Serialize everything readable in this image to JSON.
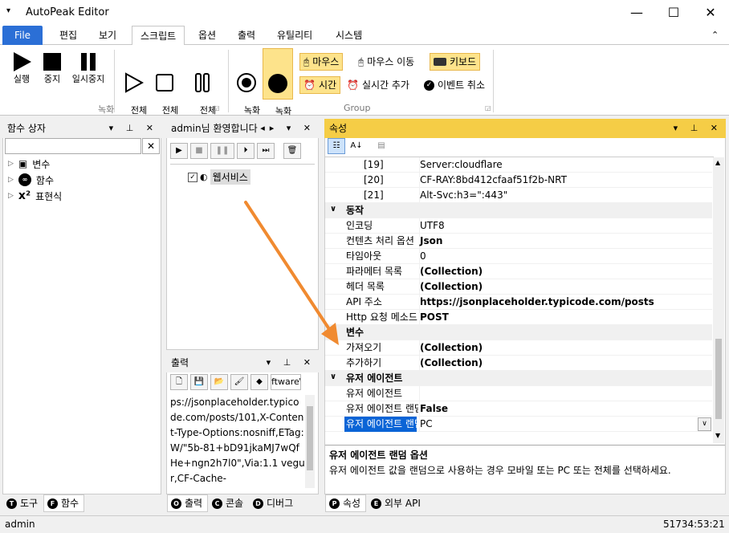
{
  "titlebar": {
    "title": "AutoPeak Editor",
    "min": "—",
    "max": "☐",
    "close": "✕"
  },
  "tabs": [
    {
      "label": "File"
    },
    {
      "label": "편집"
    },
    {
      "label": "보기"
    },
    {
      "label": "스크립트"
    },
    {
      "label": "옵션"
    },
    {
      "label": "출력"
    },
    {
      "label": "유틸리티"
    },
    {
      "label": "시스템"
    }
  ],
  "ribbon": {
    "record_group_label": "녹화",
    "group_label": "Group",
    "buttons": {
      "run": "실행",
      "stop": "중지",
      "pause": "일시중지",
      "run_all": "전체\n실행",
      "stop_all": "전체\n중지",
      "pause_all": "전체\n일시중지",
      "rec_start": "녹화\n시작",
      "rec_stop": "녹화\n중지"
    },
    "mouse": "마우스",
    "mouse_move": "마우스 이동",
    "keyboard": "키보드",
    "time": "시간",
    "realtime_add": "실시간 추가",
    "event_cancel": "이벤트 취소"
  },
  "func_panel": {
    "title": "함수 상자",
    "search_value": "",
    "tree": [
      {
        "label": "변수"
      },
      {
        "label": "함수"
      },
      {
        "label": "표현식"
      }
    ]
  },
  "script_panel": {
    "title": "admin님 환영합니다",
    "node": "웹서비스"
  },
  "output_panel": {
    "title": "출력",
    "path_text": "ftware\\",
    "text": "ps://jsonplaceholder.typicode.com/posts/101,X-Content-Type-Options:nosniff,ETag:W/\"5b-81+bD91jkaMJ7wQfHe+ngn2h7l0\",Via:1.1 vegur,CF-Cache-"
  },
  "props_panel": {
    "title": "속성",
    "rows": [
      {
        "key": "[19]",
        "value": "Server:cloudflare",
        "bold": false
      },
      {
        "key": "[20]",
        "value": "CF-RAY:8bd412cfaaf51f2b-NRT",
        "bold": false
      },
      {
        "key": "[21]",
        "value": "Alt-Svc:h3=\":443\"",
        "bold": false
      }
    ],
    "cat_action": "동작",
    "action_rows": [
      {
        "key": "인코딩",
        "value": "UTF8",
        "bold": false
      },
      {
        "key": "컨텐츠 처리 옵션",
        "value": "Json",
        "bold": true
      },
      {
        "key": "타임아웃",
        "value": "0",
        "bold": false
      },
      {
        "key": "파라메터 목록",
        "value": "(Collection)",
        "bold": true
      },
      {
        "key": "헤더 목록",
        "value": "(Collection)",
        "bold": true
      },
      {
        "key": "API 주소",
        "value": "https://jsonplaceholder.typicode.com/posts",
        "bold": true
      },
      {
        "key": "Http 요청 메소드",
        "value": "POST",
        "bold": true
      }
    ],
    "cat_var": "변수",
    "var_rows": [
      {
        "key": "가져오기",
        "value": "(Collection)",
        "bold": true
      },
      {
        "key": "추가하기",
        "value": "(Collection)",
        "bold": true
      }
    ],
    "cat_ua": "유저 에이전트",
    "ua_rows": [
      {
        "key": "유저 에이전트",
        "value": "",
        "bold": false
      },
      {
        "key": "유저 에이전트 랜덤",
        "value": "False",
        "bold": true
      },
      {
        "key": "유저 에이전트 랜덤 옵션",
        "value": "PC",
        "bold": false
      }
    ],
    "desc_title": "유저 에이전트 랜덤 옵션",
    "desc_text": "유저 에이전트 값을 랜덤으로 사용하는 경우 모바일 또는 PC 또는 전체를 선택하세요."
  },
  "bottom_tabs": {
    "left": [
      {
        "icon": "T",
        "label": "도구"
      },
      {
        "icon": "F",
        "label": "함수"
      }
    ],
    "mid": [
      {
        "icon": "O",
        "label": "출력"
      },
      {
        "icon": "C",
        "label": "콘솔"
      },
      {
        "icon": "D",
        "label": "디버그"
      }
    ],
    "right": [
      {
        "icon": "P",
        "label": "속성"
      },
      {
        "icon": "E",
        "label": "외부 API"
      }
    ]
  },
  "status": {
    "user": "admin",
    "time": "51734:53:21"
  },
  "colors": {
    "accent": "#2b6fd6",
    "highlight": "#fde38b",
    "header": "#f5cd46",
    "arrow": "#f08a30",
    "selected": "#0a64d6"
  }
}
